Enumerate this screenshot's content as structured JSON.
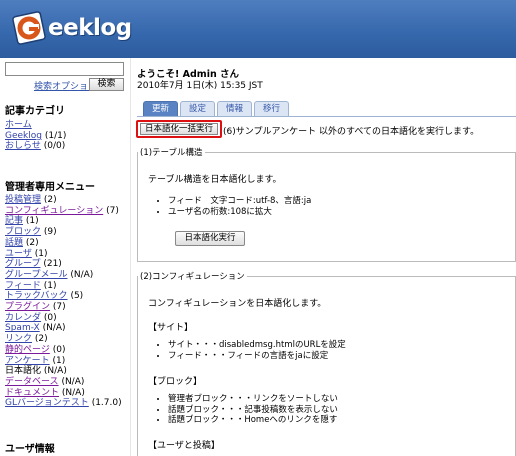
{
  "header": {
    "logo_text": "eeklog"
  },
  "sidebar": {
    "search_option": "検索オプション",
    "search_button": "検索",
    "category_title": "記事カテゴリ",
    "categories": [
      {
        "label": "ホーム",
        "count": ""
      },
      {
        "label": "Geeklog",
        "count": "(1/1)"
      },
      {
        "label": "おしらせ",
        "count": "(0/0)"
      }
    ],
    "admin_title": "管理者専用メニュー",
    "admin_items": [
      {
        "label": "投稿管理",
        "count": "(2)"
      },
      {
        "label": "コンフィギュレーション",
        "count": "(7)"
      },
      {
        "label": "記事",
        "count": "(1)"
      },
      {
        "label": "ブロック",
        "count": "(9)"
      },
      {
        "label": "話題",
        "count": "(2)"
      },
      {
        "label": "ユーザ",
        "count": "(1)"
      },
      {
        "label": "グループ",
        "count": "(21)"
      },
      {
        "label": "グループメール",
        "count": "(N/A)"
      },
      {
        "label": "フィード",
        "count": "(1)"
      },
      {
        "label": "トラックバック",
        "count": "(5)"
      },
      {
        "label": "プラグイン",
        "count": "(7)"
      },
      {
        "label": "カレンダ",
        "count": "(0)"
      },
      {
        "label": "Spam-X",
        "count": "(N/A)"
      },
      {
        "label": "リンク",
        "count": "(2)"
      },
      {
        "label": "静的ページ",
        "count": "(0)"
      },
      {
        "label": "アンケート",
        "count": "(1)"
      },
      {
        "label": "日本語化",
        "count": "(N/A)"
      },
      {
        "label": "データベース",
        "count": "(N/A)"
      },
      {
        "label": "ドキュメント",
        "count": "(N/A)"
      },
      {
        "label": "GLバージョンテスト",
        "count": "(1.7.0)"
      }
    ],
    "user_title": "ユーザ情報"
  },
  "main": {
    "welcome": "ようこそ! Admin さん",
    "date": "2010年7月 1日(木) 15:35 JST",
    "tabs": [
      "更新",
      "設定",
      "情報",
      "移行"
    ],
    "exec_all_button": "日本語化一括実行",
    "exec_all_desc": "(6)サンプルアンケート 以外のすべての日本語化を実行します。",
    "section1": {
      "legend": "(1)テーブル構造",
      "desc": "テーブル構造を日本語化します。",
      "bullets": [
        "フィード　文字コード:utf-8、言語:ja",
        "ユーザ名の桁数:108に拡大"
      ],
      "button": "日本語化実行"
    },
    "section2": {
      "legend": "(2)コンフィギュレーション",
      "desc": "コンフィギュレーションを日本語化します。",
      "site_heading": "【サイト】",
      "site_bullets": [
        "サイト・・・disabledmsg.htmlのURLを設定",
        "フィード・・・フィードの言語をjaに設定"
      ],
      "block_heading": "【ブロック】",
      "block_bullets": [
        "管理者ブロック・・・リンクをソートしない",
        "話題ブロック・・・記事投稿数を表示しない",
        "話題ブロック・・・Homeへのリンクを隠す"
      ],
      "user_heading": "【ユーザと投稿】"
    }
  }
}
